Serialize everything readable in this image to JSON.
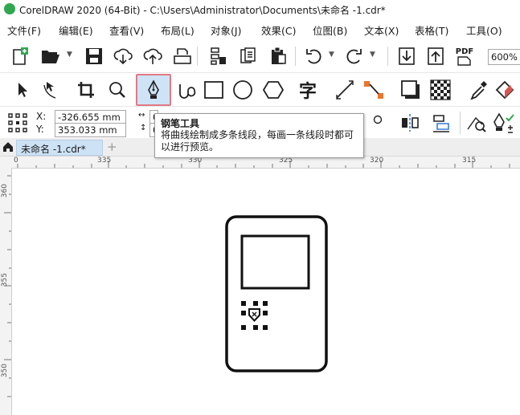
{
  "window": {
    "title": "CorelDRAW 2020 (64-Bit) - C:\\Users\\Administrator\\Documents\\未命名 -1.cdr*"
  },
  "menu": [
    "文件(F)",
    "编辑(E)",
    "查看(V)",
    "布局(L)",
    "对象(J)",
    "效果(C)",
    "位图(B)",
    "文本(X)",
    "表格(T)",
    "工具(O)"
  ],
  "toolbar": {
    "pdf_label": "PDF",
    "zoom_value": "600%"
  },
  "toolbox": {
    "text_tool_glyph": "字",
    "active_tool": "pen-tool"
  },
  "properties": {
    "x_label": "X:",
    "x_value": "-326.655 mm",
    "y_label": "Y:",
    "y_value": "353.033 mm",
    "w_partial": "0",
    "h_partial": "0"
  },
  "tooltip": {
    "title": "钢笔工具",
    "body": "将曲线绘制成多条线段，每画一条线段时都可以进行预览。"
  },
  "doc_tab": {
    "label": "未命名 -1.cdr*"
  },
  "ruler": {
    "top_ticks": [
      "0",
      "335",
      "330",
      "325",
      "320",
      "315"
    ],
    "left_ticks": [
      "360",
      "355",
      "350"
    ]
  },
  "colors": {
    "accent_red": "#d9534f",
    "active_tool_bg": "#cfe3f7",
    "tab_blue": "#cde2f5"
  }
}
